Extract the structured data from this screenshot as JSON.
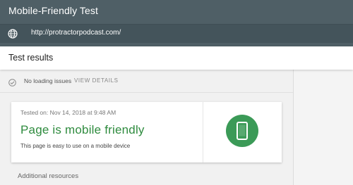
{
  "header": {
    "app_title": "Mobile-Friendly Test",
    "url": "http://protractorpodcast.com/"
  },
  "results": {
    "title": "Test results"
  },
  "status": {
    "text": "No loading issues",
    "view_details": "VIEW DETAILS"
  },
  "card": {
    "tested_on": "Tested on: Nov 14, 2018 at 9:48 AM",
    "verdict": "Page is mobile friendly",
    "description": "This page is easy to use on a mobile device"
  },
  "additional": {
    "title": "Additional resources"
  },
  "icons": {
    "globe": "globe-icon",
    "check": "check-circle-icon",
    "phone": "mobile-phone-icon"
  },
  "colors": {
    "header_bg": "#4f5f66",
    "url_bar_bg": "#44545b",
    "success_green": "#2e8b3e",
    "icon_green": "#3b9a57"
  }
}
